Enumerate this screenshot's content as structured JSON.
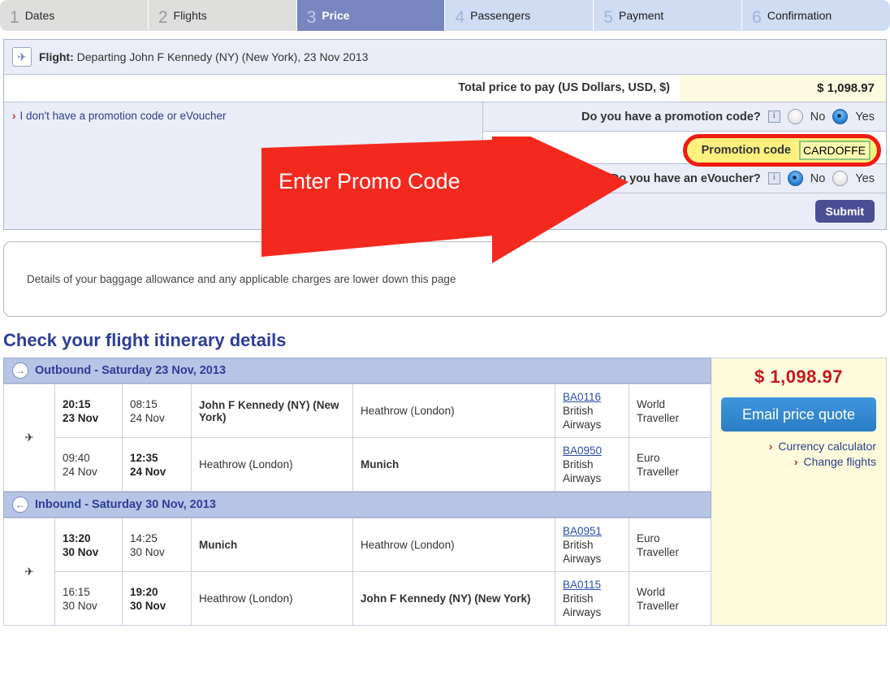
{
  "tabs": [
    {
      "num": "1",
      "label": "Dates",
      "state": "done"
    },
    {
      "num": "2",
      "label": "Flights",
      "state": "done"
    },
    {
      "num": "3",
      "label": "Price",
      "state": "active"
    },
    {
      "num": "4",
      "label": "Passengers",
      "state": "todo"
    },
    {
      "num": "5",
      "label": "Payment",
      "state": "todo"
    },
    {
      "num": "6",
      "label": "Confirmation",
      "state": "todo"
    }
  ],
  "summary": {
    "flight_prefix": "Flight:",
    "flight_text": "Departing John F Kennedy (NY) (New York), 23 Nov 2013",
    "total_label": "Total price to pay (US Dollars, USD, $)",
    "total_amount": "$ 1,098.97"
  },
  "promo": {
    "no_code_link": "I don't have a promotion code or eVoucher",
    "chevron": "›",
    "question_promo": "Do you have a promotion code?",
    "question_voucher": "Do you have an eVoucher?",
    "info_glyph": "i",
    "no_label": "No",
    "yes_label": "Yes",
    "promo_selected": "Yes",
    "voucher_selected": "No",
    "code_label": "Promotion code",
    "code_value": "CARDOFFER",
    "code_placeholder": "",
    "submit_label": "Submit"
  },
  "annotation": {
    "text": "Enter Promo Code",
    "color": "#f4291e"
  },
  "note": {
    "text": "Details of your baggage allowance and any applicable charges are lower down this page"
  },
  "itinerary": {
    "heading": "Check your flight itinerary details",
    "sections": [
      {
        "icon": "→",
        "title": "Outbound - Saturday 23 Nov, 2013",
        "legs": [
          {
            "dep_time": "20:15",
            "dep_date": "23 Nov",
            "dep_bold": true,
            "arr_time": "08:15",
            "arr_date": "24 Nov",
            "arr_bold": false,
            "from": "John F Kennedy (NY) (New York)",
            "from_bold": true,
            "to": "Heathrow (London)",
            "to_bold": false,
            "flight_no": "BA0116",
            "carrier": "British Airways",
            "cabin": "World Traveller"
          },
          {
            "dep_time": "09:40",
            "dep_date": "24 Nov",
            "dep_bold": false,
            "arr_time": "12:35",
            "arr_date": "24 Nov",
            "arr_bold": true,
            "from": "Heathrow (London)",
            "from_bold": false,
            "to": "Munich",
            "to_bold": true,
            "flight_no": "BA0950",
            "carrier": "British Airways",
            "cabin": "Euro Traveller"
          }
        ]
      },
      {
        "icon": "←",
        "title": "Inbound - Saturday 30 Nov, 2013",
        "legs": [
          {
            "dep_time": "13:20",
            "dep_date": "30 Nov",
            "dep_bold": true,
            "arr_time": "14:25",
            "arr_date": "30 Nov",
            "arr_bold": false,
            "from": "Munich",
            "from_bold": true,
            "to": "Heathrow (London)",
            "to_bold": false,
            "flight_no": "BA0951",
            "carrier": "British Airways",
            "cabin": "Euro Traveller"
          },
          {
            "dep_time": "16:15",
            "dep_date": "30 Nov",
            "dep_bold": false,
            "arr_time": "19:20",
            "arr_date": "30 Nov",
            "arr_bold": true,
            "from": "Heathrow (London)",
            "from_bold": false,
            "to": "John F Kennedy (NY) (New York)",
            "to_bold": true,
            "flight_no": "BA0115",
            "carrier": "British Airways",
            "cabin": "World Traveller"
          }
        ]
      }
    ]
  },
  "aside": {
    "price": "$ 1,098.97",
    "email_button": "Email price quote",
    "links": [
      {
        "chevron": "›",
        "label": "Currency calculator"
      },
      {
        "chevron": "›",
        "label": "Change flights"
      }
    ]
  }
}
